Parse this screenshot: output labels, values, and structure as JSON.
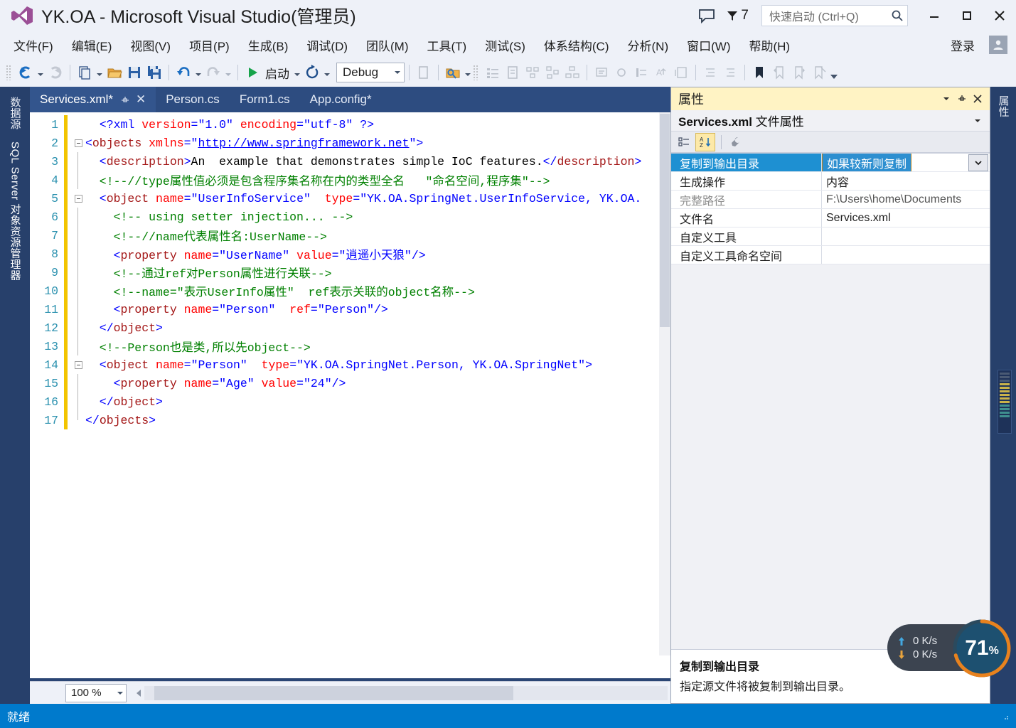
{
  "window": {
    "title": "YK.OA - Microsoft Visual Studio(管理员)",
    "notification_count": "7",
    "quick_launch_placeholder": "快速启动 (Ctrl+Q)",
    "minimize_label": "─",
    "maximize_label": "□",
    "close_label": "✕"
  },
  "menubar": {
    "items": [
      {
        "label": "文件(F)"
      },
      {
        "label": "编辑(E)"
      },
      {
        "label": "视图(V)"
      },
      {
        "label": "项目(P)"
      },
      {
        "label": "生成(B)"
      },
      {
        "label": "调试(D)"
      },
      {
        "label": "团队(M)"
      },
      {
        "label": "工具(T)"
      },
      {
        "label": "测试(S)"
      },
      {
        "label": "体系结构(C)"
      },
      {
        "label": "分析(N)"
      },
      {
        "label": "窗口(W)"
      },
      {
        "label": "帮助(H)"
      }
    ],
    "signin_label": "登录"
  },
  "toolbar": {
    "start_label": "启动",
    "config_value": "Debug"
  },
  "left_dock": {
    "tabs": [
      {
        "label": "数据源"
      },
      {
        "label": "SQL Server 对象资源管理器"
      }
    ]
  },
  "right_dock": {
    "tabs": [
      {
        "label": "属性"
      }
    ]
  },
  "editor": {
    "tabs": [
      {
        "label": "Services.xml*",
        "active": true
      },
      {
        "label": "Person.cs",
        "active": false
      },
      {
        "label": "Form1.cs",
        "active": false
      },
      {
        "label": "App.config*",
        "active": false
      }
    ],
    "zoom_level": "100 %",
    "lines": [
      {
        "n": "1",
        "fold": "none",
        "bar": true,
        "tokens": [
          {
            "t": "  ",
            "c": "s-txt"
          },
          {
            "t": "<?xml ",
            "c": "s-punc"
          },
          {
            "t": "version",
            "c": "s-attr"
          },
          {
            "t": "=",
            "c": "s-punc"
          },
          {
            "t": "\"1.0\"",
            "c": "s-val"
          },
          {
            "t": " ",
            "c": "s-txt"
          },
          {
            "t": "encoding",
            "c": "s-attr"
          },
          {
            "t": "=",
            "c": "s-punc"
          },
          {
            "t": "\"utf-8\"",
            "c": "s-val"
          },
          {
            "t": " ?>",
            "c": "s-punc"
          }
        ]
      },
      {
        "n": "2",
        "fold": "box",
        "bar": true,
        "tokens": [
          {
            "t": "<",
            "c": "s-punc"
          },
          {
            "t": "objects",
            "c": "s-tag"
          },
          {
            "t": " ",
            "c": "s-txt"
          },
          {
            "t": "xmlns",
            "c": "s-attr"
          },
          {
            "t": "=",
            "c": "s-punc"
          },
          {
            "t": "\"",
            "c": "s-val"
          },
          {
            "t": "http://www.springframework.net",
            "c": "s-link"
          },
          {
            "t": "\">",
            "c": "s-val"
          }
        ]
      },
      {
        "n": "3",
        "fold": "line",
        "bar": true,
        "tokens": [
          {
            "t": "  <",
            "c": "s-punc"
          },
          {
            "t": "description",
            "c": "s-tag"
          },
          {
            "t": ">",
            "c": "s-punc"
          },
          {
            "t": "An  example that demonstrates simple IoC features.",
            "c": "s-txt"
          },
          {
            "t": "</",
            "c": "s-punc"
          },
          {
            "t": "description",
            "c": "s-tag"
          },
          {
            "t": ">",
            "c": "s-punc"
          }
        ]
      },
      {
        "n": "4",
        "fold": "line",
        "bar": true,
        "tokens": [
          {
            "t": "  <!--//type属性值必须是包含程序集名称在内的类型全名   \"命名空间,程序集\"-->",
            "c": "s-cmt"
          }
        ]
      },
      {
        "n": "5",
        "fold": "box",
        "bar": true,
        "tokens": [
          {
            "t": "  <",
            "c": "s-punc"
          },
          {
            "t": "object",
            "c": "s-tag"
          },
          {
            "t": " ",
            "c": "s-txt"
          },
          {
            "t": "name",
            "c": "s-attr"
          },
          {
            "t": "=",
            "c": "s-punc"
          },
          {
            "t": "\"UserInfoService\"",
            "c": "s-val"
          },
          {
            "t": "  ",
            "c": "s-txt"
          },
          {
            "t": "type",
            "c": "s-attr"
          },
          {
            "t": "=",
            "c": "s-punc"
          },
          {
            "t": "\"YK.OA.SpringNet.UserInfoService, YK.OA.",
            "c": "s-val"
          }
        ]
      },
      {
        "n": "6",
        "fold": "line",
        "bar": true,
        "tokens": [
          {
            "t": "    <!-- using setter injection... -->",
            "c": "s-cmt"
          }
        ]
      },
      {
        "n": "7",
        "fold": "line",
        "bar": true,
        "tokens": [
          {
            "t": "    <!--//name代表属性名:UserName-->",
            "c": "s-cmt"
          }
        ]
      },
      {
        "n": "8",
        "fold": "line",
        "bar": true,
        "tokens": [
          {
            "t": "    <",
            "c": "s-punc"
          },
          {
            "t": "property",
            "c": "s-tag"
          },
          {
            "t": " ",
            "c": "s-txt"
          },
          {
            "t": "name",
            "c": "s-attr"
          },
          {
            "t": "=",
            "c": "s-punc"
          },
          {
            "t": "\"UserName\"",
            "c": "s-val"
          },
          {
            "t": " ",
            "c": "s-txt"
          },
          {
            "t": "value",
            "c": "s-attr"
          },
          {
            "t": "=",
            "c": "s-punc"
          },
          {
            "t": "\"逍遥小天狼\"",
            "c": "s-val"
          },
          {
            "t": "/>",
            "c": "s-punc"
          }
        ]
      },
      {
        "n": "9",
        "fold": "line",
        "bar": true,
        "tokens": [
          {
            "t": "    <!--通过ref对Person属性进行关联-->",
            "c": "s-cmt"
          }
        ]
      },
      {
        "n": "10",
        "fold": "line",
        "bar": true,
        "tokens": [
          {
            "t": "    <!--name=\"表示UserInfo属性\"  ref表示关联的object名称-->",
            "c": "s-cmt"
          }
        ]
      },
      {
        "n": "11",
        "fold": "line",
        "bar": true,
        "tokens": [
          {
            "t": "    <",
            "c": "s-punc"
          },
          {
            "t": "property",
            "c": "s-tag"
          },
          {
            "t": " ",
            "c": "s-txt"
          },
          {
            "t": "name",
            "c": "s-attr"
          },
          {
            "t": "=",
            "c": "s-punc"
          },
          {
            "t": "\"Person\"",
            "c": "s-val"
          },
          {
            "t": "  ",
            "c": "s-txt"
          },
          {
            "t": "ref",
            "c": "s-attr"
          },
          {
            "t": "=",
            "c": "s-punc"
          },
          {
            "t": "\"Person\"",
            "c": "s-val"
          },
          {
            "t": "/>",
            "c": "s-punc"
          }
        ]
      },
      {
        "n": "12",
        "fold": "line",
        "bar": true,
        "tokens": [
          {
            "t": "  </",
            "c": "s-punc"
          },
          {
            "t": "object",
            "c": "s-tag"
          },
          {
            "t": ">",
            "c": "s-punc"
          }
        ]
      },
      {
        "n": "13",
        "fold": "line",
        "bar": true,
        "tokens": [
          {
            "t": "  <!--Person也是类,所以先object-->",
            "c": "s-cmt"
          }
        ]
      },
      {
        "n": "14",
        "fold": "box",
        "bar": true,
        "tokens": [
          {
            "t": "  <",
            "c": "s-punc"
          },
          {
            "t": "object",
            "c": "s-tag"
          },
          {
            "t": " ",
            "c": "s-txt"
          },
          {
            "t": "name",
            "c": "s-attr"
          },
          {
            "t": "=",
            "c": "s-punc"
          },
          {
            "t": "\"Person\"",
            "c": "s-val"
          },
          {
            "t": "  ",
            "c": "s-txt"
          },
          {
            "t": "type",
            "c": "s-attr"
          },
          {
            "t": "=",
            "c": "s-punc"
          },
          {
            "t": "\"YK.OA.SpringNet.Person, YK.OA.SpringNet\"",
            "c": "s-val"
          },
          {
            "t": ">",
            "c": "s-punc"
          }
        ]
      },
      {
        "n": "15",
        "fold": "line",
        "bar": true,
        "tokens": [
          {
            "t": "    <",
            "c": "s-punc"
          },
          {
            "t": "property",
            "c": "s-tag"
          },
          {
            "t": " ",
            "c": "s-txt"
          },
          {
            "t": "name",
            "c": "s-attr"
          },
          {
            "t": "=",
            "c": "s-punc"
          },
          {
            "t": "\"Age\"",
            "c": "s-val"
          },
          {
            "t": " ",
            "c": "s-txt"
          },
          {
            "t": "value",
            "c": "s-attr"
          },
          {
            "t": "=",
            "c": "s-punc"
          },
          {
            "t": "\"24\"",
            "c": "s-val"
          },
          {
            "t": "/>",
            "c": "s-punc"
          }
        ]
      },
      {
        "n": "16",
        "fold": "line",
        "bar": true,
        "tokens": [
          {
            "t": "  </",
            "c": "s-punc"
          },
          {
            "t": "object",
            "c": "s-tag"
          },
          {
            "t": ">",
            "c": "s-punc"
          }
        ]
      },
      {
        "n": "17",
        "fold": "endline",
        "bar": true,
        "tokens": [
          {
            "t": "</",
            "c": "s-punc"
          },
          {
            "t": "objects",
            "c": "s-tag"
          },
          {
            "t": ">",
            "c": "s-punc"
          }
        ]
      }
    ]
  },
  "properties_panel": {
    "header_title": "属性",
    "subject_bold": "Services.xml",
    "subject_rest": " 文件属性",
    "rows": [
      {
        "name": "复制到输出目录",
        "value": "如果较新则复制",
        "selected": true,
        "editing": true,
        "dim": false
      },
      {
        "name": "生成操作",
        "value": "内容",
        "selected": false,
        "editing": false,
        "dim": false
      },
      {
        "name": "完整路径",
        "value": "F:\\Users\\home\\Documents",
        "selected": false,
        "editing": false,
        "dim": true
      },
      {
        "name": "文件名",
        "value": "Services.xml",
        "selected": false,
        "editing": false,
        "dim": false
      },
      {
        "name": "自定义工具",
        "value": "",
        "selected": false,
        "editing": false,
        "dim": false
      },
      {
        "name": "自定义工具命名空间",
        "value": "",
        "selected": false,
        "editing": false,
        "dim": false
      }
    ],
    "description_title": "复制到输出目录",
    "description_body": "指定源文件将被复制到输出目录。"
  },
  "net_widget": {
    "upload_speed": "0 K/s",
    "download_speed": "0 K/s",
    "gauge_value": "71",
    "gauge_unit": "%",
    "gauge_color": "#e8821e"
  },
  "statusbar": {
    "text": "就绪"
  }
}
